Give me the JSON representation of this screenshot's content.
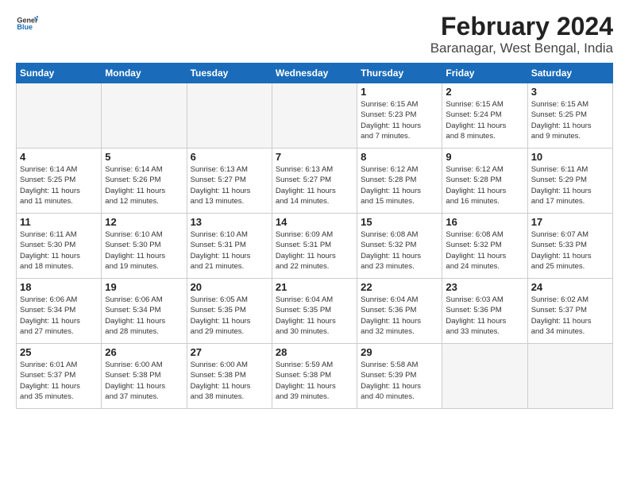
{
  "header": {
    "logo_general": "General",
    "logo_blue": "Blue",
    "title": "February 2024",
    "subtitle": "Baranagar, West Bengal, India"
  },
  "days_of_week": [
    "Sunday",
    "Monday",
    "Tuesday",
    "Wednesday",
    "Thursday",
    "Friday",
    "Saturday"
  ],
  "weeks": [
    [
      {
        "day": "",
        "info": ""
      },
      {
        "day": "",
        "info": ""
      },
      {
        "day": "",
        "info": ""
      },
      {
        "day": "",
        "info": ""
      },
      {
        "day": "1",
        "info": "Sunrise: 6:15 AM\nSunset: 5:23 PM\nDaylight: 11 hours\nand 7 minutes."
      },
      {
        "day": "2",
        "info": "Sunrise: 6:15 AM\nSunset: 5:24 PM\nDaylight: 11 hours\nand 8 minutes."
      },
      {
        "day": "3",
        "info": "Sunrise: 6:15 AM\nSunset: 5:25 PM\nDaylight: 11 hours\nand 9 minutes."
      }
    ],
    [
      {
        "day": "4",
        "info": "Sunrise: 6:14 AM\nSunset: 5:25 PM\nDaylight: 11 hours\nand 11 minutes."
      },
      {
        "day": "5",
        "info": "Sunrise: 6:14 AM\nSunset: 5:26 PM\nDaylight: 11 hours\nand 12 minutes."
      },
      {
        "day": "6",
        "info": "Sunrise: 6:13 AM\nSunset: 5:27 PM\nDaylight: 11 hours\nand 13 minutes."
      },
      {
        "day": "7",
        "info": "Sunrise: 6:13 AM\nSunset: 5:27 PM\nDaylight: 11 hours\nand 14 minutes."
      },
      {
        "day": "8",
        "info": "Sunrise: 6:12 AM\nSunset: 5:28 PM\nDaylight: 11 hours\nand 15 minutes."
      },
      {
        "day": "9",
        "info": "Sunrise: 6:12 AM\nSunset: 5:28 PM\nDaylight: 11 hours\nand 16 minutes."
      },
      {
        "day": "10",
        "info": "Sunrise: 6:11 AM\nSunset: 5:29 PM\nDaylight: 11 hours\nand 17 minutes."
      }
    ],
    [
      {
        "day": "11",
        "info": "Sunrise: 6:11 AM\nSunset: 5:30 PM\nDaylight: 11 hours\nand 18 minutes."
      },
      {
        "day": "12",
        "info": "Sunrise: 6:10 AM\nSunset: 5:30 PM\nDaylight: 11 hours\nand 19 minutes."
      },
      {
        "day": "13",
        "info": "Sunrise: 6:10 AM\nSunset: 5:31 PM\nDaylight: 11 hours\nand 21 minutes."
      },
      {
        "day": "14",
        "info": "Sunrise: 6:09 AM\nSunset: 5:31 PM\nDaylight: 11 hours\nand 22 minutes."
      },
      {
        "day": "15",
        "info": "Sunrise: 6:08 AM\nSunset: 5:32 PM\nDaylight: 11 hours\nand 23 minutes."
      },
      {
        "day": "16",
        "info": "Sunrise: 6:08 AM\nSunset: 5:32 PM\nDaylight: 11 hours\nand 24 minutes."
      },
      {
        "day": "17",
        "info": "Sunrise: 6:07 AM\nSunset: 5:33 PM\nDaylight: 11 hours\nand 25 minutes."
      }
    ],
    [
      {
        "day": "18",
        "info": "Sunrise: 6:06 AM\nSunset: 5:34 PM\nDaylight: 11 hours\nand 27 minutes."
      },
      {
        "day": "19",
        "info": "Sunrise: 6:06 AM\nSunset: 5:34 PM\nDaylight: 11 hours\nand 28 minutes."
      },
      {
        "day": "20",
        "info": "Sunrise: 6:05 AM\nSunset: 5:35 PM\nDaylight: 11 hours\nand 29 minutes."
      },
      {
        "day": "21",
        "info": "Sunrise: 6:04 AM\nSunset: 5:35 PM\nDaylight: 11 hours\nand 30 minutes."
      },
      {
        "day": "22",
        "info": "Sunrise: 6:04 AM\nSunset: 5:36 PM\nDaylight: 11 hours\nand 32 minutes."
      },
      {
        "day": "23",
        "info": "Sunrise: 6:03 AM\nSunset: 5:36 PM\nDaylight: 11 hours\nand 33 minutes."
      },
      {
        "day": "24",
        "info": "Sunrise: 6:02 AM\nSunset: 5:37 PM\nDaylight: 11 hours\nand 34 minutes."
      }
    ],
    [
      {
        "day": "25",
        "info": "Sunrise: 6:01 AM\nSunset: 5:37 PM\nDaylight: 11 hours\nand 35 minutes."
      },
      {
        "day": "26",
        "info": "Sunrise: 6:00 AM\nSunset: 5:38 PM\nDaylight: 11 hours\nand 37 minutes."
      },
      {
        "day": "27",
        "info": "Sunrise: 6:00 AM\nSunset: 5:38 PM\nDaylight: 11 hours\nand 38 minutes."
      },
      {
        "day": "28",
        "info": "Sunrise: 5:59 AM\nSunset: 5:38 PM\nDaylight: 11 hours\nand 39 minutes."
      },
      {
        "day": "29",
        "info": "Sunrise: 5:58 AM\nSunset: 5:39 PM\nDaylight: 11 hours\nand 40 minutes."
      },
      {
        "day": "",
        "info": ""
      },
      {
        "day": "",
        "info": ""
      }
    ]
  ]
}
